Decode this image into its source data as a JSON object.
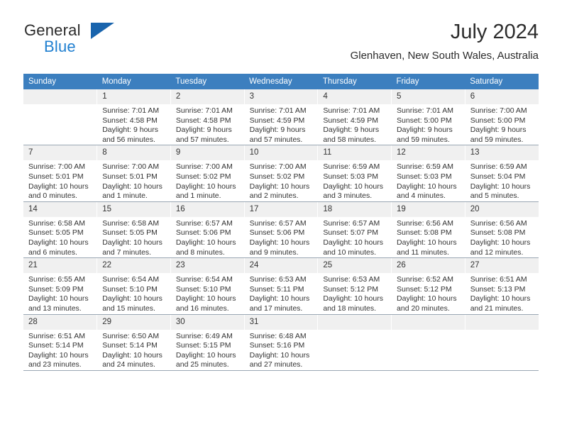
{
  "brand": {
    "name_part1": "General",
    "name_part2": "Blue",
    "logo_icon": "triangle-logo-icon"
  },
  "header": {
    "month_title": "July 2024",
    "location": "Glenhaven, New South Wales, Australia"
  },
  "colors": {
    "header_band": "#3C7FBF",
    "daynum_band": "#F0F0F0",
    "brand_blue": "#1f7fd0",
    "logo_blue": "#1964ad",
    "grid_line": "#9aa7b4"
  },
  "calendar": {
    "weekday_headers": [
      "Sunday",
      "Monday",
      "Tuesday",
      "Wednesday",
      "Thursday",
      "Friday",
      "Saturday"
    ],
    "weeks": [
      [
        {
          "day": "",
          "empty": true,
          "sunrise": "",
          "sunset": "",
          "daylight_line1": "",
          "daylight_line2": ""
        },
        {
          "day": "1",
          "sunrise": "Sunrise: 7:01 AM",
          "sunset": "Sunset: 4:58 PM",
          "daylight_line1": "Daylight: 9 hours",
          "daylight_line2": "and 56 minutes."
        },
        {
          "day": "2",
          "sunrise": "Sunrise: 7:01 AM",
          "sunset": "Sunset: 4:58 PM",
          "daylight_line1": "Daylight: 9 hours",
          "daylight_line2": "and 57 minutes."
        },
        {
          "day": "3",
          "sunrise": "Sunrise: 7:01 AM",
          "sunset": "Sunset: 4:59 PM",
          "daylight_line1": "Daylight: 9 hours",
          "daylight_line2": "and 57 minutes."
        },
        {
          "day": "4",
          "sunrise": "Sunrise: 7:01 AM",
          "sunset": "Sunset: 4:59 PM",
          "daylight_line1": "Daylight: 9 hours",
          "daylight_line2": "and 58 minutes."
        },
        {
          "day": "5",
          "sunrise": "Sunrise: 7:01 AM",
          "sunset": "Sunset: 5:00 PM",
          "daylight_line1": "Daylight: 9 hours",
          "daylight_line2": "and 59 minutes."
        },
        {
          "day": "6",
          "sunrise": "Sunrise: 7:00 AM",
          "sunset": "Sunset: 5:00 PM",
          "daylight_line1": "Daylight: 9 hours",
          "daylight_line2": "and 59 minutes."
        }
      ],
      [
        {
          "day": "7",
          "sunrise": "Sunrise: 7:00 AM",
          "sunset": "Sunset: 5:01 PM",
          "daylight_line1": "Daylight: 10 hours",
          "daylight_line2": "and 0 minutes."
        },
        {
          "day": "8",
          "sunrise": "Sunrise: 7:00 AM",
          "sunset": "Sunset: 5:01 PM",
          "daylight_line1": "Daylight: 10 hours",
          "daylight_line2": "and 1 minute."
        },
        {
          "day": "9",
          "sunrise": "Sunrise: 7:00 AM",
          "sunset": "Sunset: 5:02 PM",
          "daylight_line1": "Daylight: 10 hours",
          "daylight_line2": "and 1 minute."
        },
        {
          "day": "10",
          "sunrise": "Sunrise: 7:00 AM",
          "sunset": "Sunset: 5:02 PM",
          "daylight_line1": "Daylight: 10 hours",
          "daylight_line2": "and 2 minutes."
        },
        {
          "day": "11",
          "sunrise": "Sunrise: 6:59 AM",
          "sunset": "Sunset: 5:03 PM",
          "daylight_line1": "Daylight: 10 hours",
          "daylight_line2": "and 3 minutes."
        },
        {
          "day": "12",
          "sunrise": "Sunrise: 6:59 AM",
          "sunset": "Sunset: 5:03 PM",
          "daylight_line1": "Daylight: 10 hours",
          "daylight_line2": "and 4 minutes."
        },
        {
          "day": "13",
          "sunrise": "Sunrise: 6:59 AM",
          "sunset": "Sunset: 5:04 PM",
          "daylight_line1": "Daylight: 10 hours",
          "daylight_line2": "and 5 minutes."
        }
      ],
      [
        {
          "day": "14",
          "sunrise": "Sunrise: 6:58 AM",
          "sunset": "Sunset: 5:05 PM",
          "daylight_line1": "Daylight: 10 hours",
          "daylight_line2": "and 6 minutes."
        },
        {
          "day": "15",
          "sunrise": "Sunrise: 6:58 AM",
          "sunset": "Sunset: 5:05 PM",
          "daylight_line1": "Daylight: 10 hours",
          "daylight_line2": "and 7 minutes."
        },
        {
          "day": "16",
          "sunrise": "Sunrise: 6:57 AM",
          "sunset": "Sunset: 5:06 PM",
          "daylight_line1": "Daylight: 10 hours",
          "daylight_line2": "and 8 minutes."
        },
        {
          "day": "17",
          "sunrise": "Sunrise: 6:57 AM",
          "sunset": "Sunset: 5:06 PM",
          "daylight_line1": "Daylight: 10 hours",
          "daylight_line2": "and 9 minutes."
        },
        {
          "day": "18",
          "sunrise": "Sunrise: 6:57 AM",
          "sunset": "Sunset: 5:07 PM",
          "daylight_line1": "Daylight: 10 hours",
          "daylight_line2": "and 10 minutes."
        },
        {
          "day": "19",
          "sunrise": "Sunrise: 6:56 AM",
          "sunset": "Sunset: 5:08 PM",
          "daylight_line1": "Daylight: 10 hours",
          "daylight_line2": "and 11 minutes."
        },
        {
          "day": "20",
          "sunrise": "Sunrise: 6:56 AM",
          "sunset": "Sunset: 5:08 PM",
          "daylight_line1": "Daylight: 10 hours",
          "daylight_line2": "and 12 minutes."
        }
      ],
      [
        {
          "day": "21",
          "sunrise": "Sunrise: 6:55 AM",
          "sunset": "Sunset: 5:09 PM",
          "daylight_line1": "Daylight: 10 hours",
          "daylight_line2": "and 13 minutes."
        },
        {
          "day": "22",
          "sunrise": "Sunrise: 6:54 AM",
          "sunset": "Sunset: 5:10 PM",
          "daylight_line1": "Daylight: 10 hours",
          "daylight_line2": "and 15 minutes."
        },
        {
          "day": "23",
          "sunrise": "Sunrise: 6:54 AM",
          "sunset": "Sunset: 5:10 PM",
          "daylight_line1": "Daylight: 10 hours",
          "daylight_line2": "and 16 minutes."
        },
        {
          "day": "24",
          "sunrise": "Sunrise: 6:53 AM",
          "sunset": "Sunset: 5:11 PM",
          "daylight_line1": "Daylight: 10 hours",
          "daylight_line2": "and 17 minutes."
        },
        {
          "day": "25",
          "sunrise": "Sunrise: 6:53 AM",
          "sunset": "Sunset: 5:12 PM",
          "daylight_line1": "Daylight: 10 hours",
          "daylight_line2": "and 18 minutes."
        },
        {
          "day": "26",
          "sunrise": "Sunrise: 6:52 AM",
          "sunset": "Sunset: 5:12 PM",
          "daylight_line1": "Daylight: 10 hours",
          "daylight_line2": "and 20 minutes."
        },
        {
          "day": "27",
          "sunrise": "Sunrise: 6:51 AM",
          "sunset": "Sunset: 5:13 PM",
          "daylight_line1": "Daylight: 10 hours",
          "daylight_line2": "and 21 minutes."
        }
      ],
      [
        {
          "day": "28",
          "sunrise": "Sunrise: 6:51 AM",
          "sunset": "Sunset: 5:14 PM",
          "daylight_line1": "Daylight: 10 hours",
          "daylight_line2": "and 23 minutes."
        },
        {
          "day": "29",
          "sunrise": "Sunrise: 6:50 AM",
          "sunset": "Sunset: 5:14 PM",
          "daylight_line1": "Daylight: 10 hours",
          "daylight_line2": "and 24 minutes."
        },
        {
          "day": "30",
          "sunrise": "Sunrise: 6:49 AM",
          "sunset": "Sunset: 5:15 PM",
          "daylight_line1": "Daylight: 10 hours",
          "daylight_line2": "and 25 minutes."
        },
        {
          "day": "31",
          "sunrise": "Sunrise: 6:48 AM",
          "sunset": "Sunset: 5:16 PM",
          "daylight_line1": "Daylight: 10 hours",
          "daylight_line2": "and 27 minutes."
        },
        {
          "day": "",
          "empty": true,
          "sunrise": "",
          "sunset": "",
          "daylight_line1": "",
          "daylight_line2": ""
        },
        {
          "day": "",
          "empty": true,
          "sunrise": "",
          "sunset": "",
          "daylight_line1": "",
          "daylight_line2": ""
        },
        {
          "day": "",
          "empty": true,
          "sunrise": "",
          "sunset": "",
          "daylight_line1": "",
          "daylight_line2": ""
        }
      ]
    ]
  }
}
